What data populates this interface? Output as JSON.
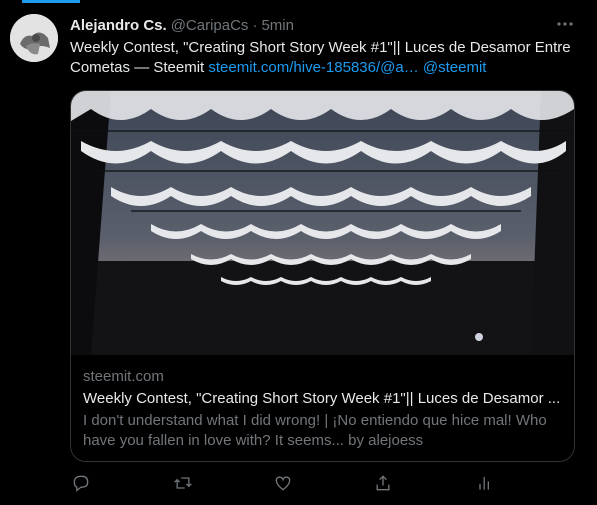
{
  "tweet": {
    "author_name": "Alejandro Cs.",
    "handle": "@CaripaCs",
    "separator": "·",
    "time": "5min",
    "more_icon": "ellipsis-icon",
    "text_main": "Weekly Contest, \"Creating Short Story Week #1\"|| Luces de Desamor Entre Cometas — Steemit",
    "text_link": "steemit.com/hive-185836/@a…",
    "text_mention": "@steemit"
  },
  "card": {
    "domain": "steemit.com",
    "title": "Weekly Contest, \"Creating Short Story Week #1\"|| Luces de Desamor ...",
    "description": "I don't understand what I did wrong! | ¡No entiendo que hice mal! Who have you fallen in love with? It seems... by alejoess"
  },
  "actions": [
    {
      "name": "reply",
      "icon": "reply-icon"
    },
    {
      "name": "retweet",
      "icon": "retweet-icon"
    },
    {
      "name": "like",
      "icon": "heart-icon"
    },
    {
      "name": "share",
      "icon": "share-icon"
    },
    {
      "name": "analytics",
      "icon": "analytics-icon"
    }
  ],
  "colors": {
    "background": "#000000",
    "text_primary": "#e7e9ea",
    "text_secondary": "#71767b",
    "link": "#1d9bf0",
    "border": "#2f3336"
  }
}
